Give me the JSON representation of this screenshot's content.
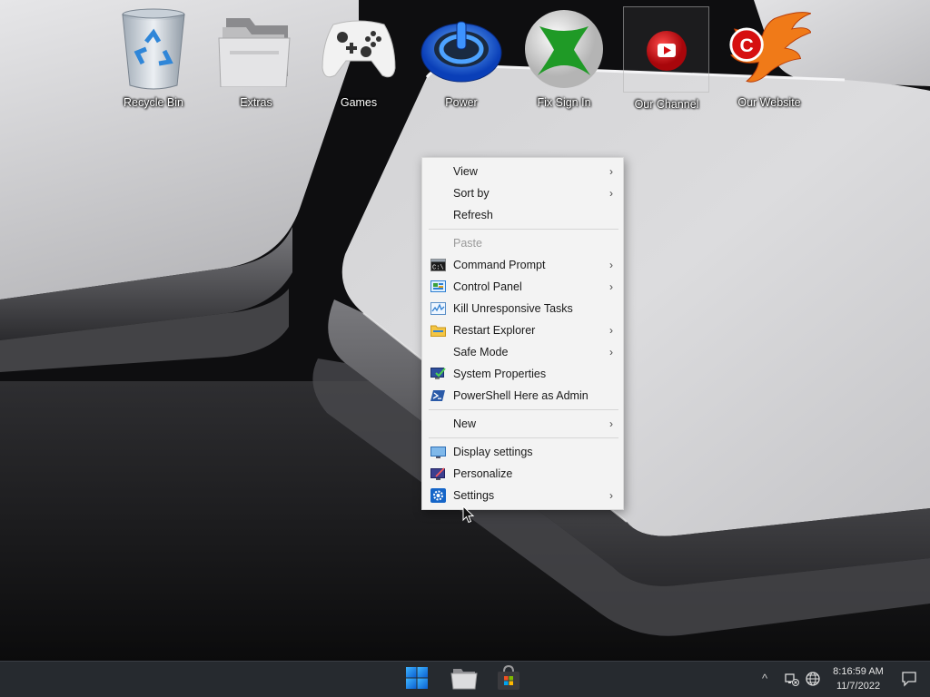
{
  "desktop": {
    "icons": [
      {
        "label": "Recycle Bin",
        "icon": "recycle-bin-icon"
      },
      {
        "label": "Extras",
        "icon": "folder-icon"
      },
      {
        "label": "Games",
        "icon": "game-controller-icon"
      },
      {
        "label": "Power",
        "icon": "power-icon"
      },
      {
        "label": "Fix Sign In",
        "icon": "xbox-icon"
      },
      {
        "label": "Our Channel",
        "icon": "youtube-icon"
      },
      {
        "label": "Our Website",
        "icon": "phoenix-logo-icon"
      }
    ]
  },
  "context_menu": {
    "items": [
      {
        "label": "View",
        "submenu": true
      },
      {
        "label": "Sort by",
        "submenu": true
      },
      {
        "label": "Refresh",
        "submenu": false
      },
      {
        "label": "Paste",
        "submenu": false,
        "disabled": true
      },
      {
        "label": "Command Prompt",
        "submenu": true,
        "icon": "command-prompt-icon"
      },
      {
        "label": "Control Panel",
        "submenu": true,
        "icon": "control-panel-icon"
      },
      {
        "label": "Kill Unresponsive Tasks",
        "submenu": false,
        "icon": "task-manager-icon"
      },
      {
        "label": "Restart Explorer",
        "submenu": true,
        "icon": "file-explorer-icon"
      },
      {
        "label": "Safe Mode",
        "submenu": true
      },
      {
        "label": "System Properties",
        "submenu": false,
        "icon": "system-properties-icon"
      },
      {
        "label": "PowerShell Here as Admin",
        "submenu": false,
        "icon": "powershell-icon"
      },
      {
        "label": "New",
        "submenu": true
      },
      {
        "label": "Display settings",
        "submenu": false,
        "icon": "display-icon"
      },
      {
        "label": "Personalize",
        "submenu": false,
        "icon": "personalize-icon"
      },
      {
        "label": "Settings",
        "submenu": true,
        "icon": "settings-gear-icon"
      }
    ],
    "arrow_glyph": "›"
  },
  "taskbar": {
    "pinned": [
      {
        "name": "start-button",
        "icon": "windows-logo-icon"
      },
      {
        "name": "file-explorer-button",
        "icon": "folder-icon"
      },
      {
        "name": "store-button",
        "icon": "store-icon"
      }
    ],
    "tray": {
      "chevron": "^",
      "time": "8:16:59 AM",
      "date": "11/7/2022"
    }
  },
  "colors": {
    "menu_bg": "#f3f3f3",
    "taskbar_bg": "#262a2f",
    "accent_blue": "#0a66d8"
  }
}
